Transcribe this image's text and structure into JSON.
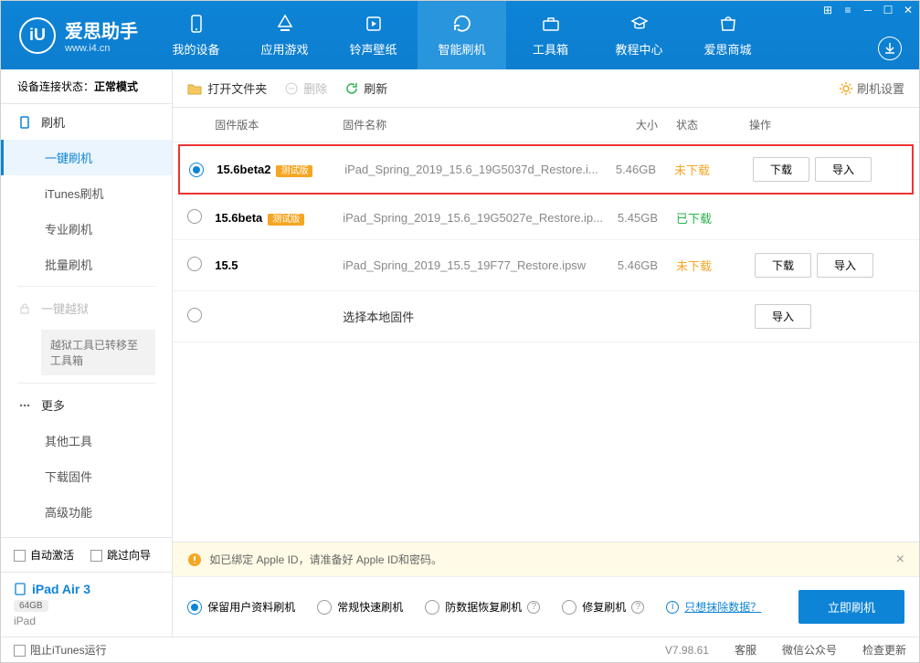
{
  "logo": {
    "text": "爱思助手",
    "sub": "www.i4.cn",
    "initial": "iU"
  },
  "nav": [
    {
      "label": "我的设备",
      "icon": "device"
    },
    {
      "label": "应用游戏",
      "icon": "apps"
    },
    {
      "label": "铃声壁纸",
      "icon": "ringtone"
    },
    {
      "label": "智能刷机",
      "icon": "flash",
      "active": true
    },
    {
      "label": "工具箱",
      "icon": "toolbox"
    },
    {
      "label": "教程中心",
      "icon": "tutorial"
    },
    {
      "label": "爱思商城",
      "icon": "store"
    }
  ],
  "sidebar": {
    "conn_label": "设备连接状态：",
    "conn_value": "正常模式",
    "groups": {
      "flash": {
        "title": "刷机",
        "items": [
          "一键刷机",
          "iTunes刷机",
          "专业刷机",
          "批量刷机"
        ]
      },
      "jailbreak": {
        "title": "一键越狱",
        "note": "越狱工具已转移至工具箱"
      },
      "more": {
        "title": "更多",
        "items": [
          "其他工具",
          "下载固件",
          "高级功能"
        ]
      }
    },
    "bottom": {
      "auto_activate": "自动激活",
      "skip_guide": "跳过向导",
      "device_name": "iPad Air 3",
      "storage": "64GB",
      "device_type": "iPad"
    }
  },
  "toolbar": {
    "open_folder": "打开文件夹",
    "delete": "删除",
    "refresh": "刷新",
    "settings": "刷机设置"
  },
  "table": {
    "headers": {
      "version": "固件版本",
      "name": "固件名称",
      "size": "大小",
      "status": "状态",
      "action": "操作"
    },
    "rows": [
      {
        "selected": true,
        "version": "15.6beta2",
        "beta": "测试版",
        "name": "iPad_Spring_2019_15.6_19G5037d_Restore.i...",
        "size": "5.46GB",
        "status": "未下载",
        "status_class": "not",
        "buttons": [
          "下载",
          "导入"
        ],
        "highlight": true
      },
      {
        "selected": false,
        "version": "15.6beta",
        "beta": "测试版",
        "name": "iPad_Spring_2019_15.6_19G5027e_Restore.ip...",
        "size": "5.45GB",
        "status": "已下载",
        "status_class": "done",
        "buttons": []
      },
      {
        "selected": false,
        "version": "15.5",
        "beta": "",
        "name": "iPad_Spring_2019_15.5_19F77_Restore.ipsw",
        "size": "5.46GB",
        "status": "未下载",
        "status_class": "not",
        "buttons": [
          "下载",
          "导入"
        ]
      },
      {
        "selected": false,
        "version": "",
        "beta": "",
        "name_override": "选择本地固件",
        "size": "",
        "status": "",
        "status_class": "",
        "buttons": [
          "导入"
        ]
      }
    ]
  },
  "bottom": {
    "warning": "如已绑定 Apple ID，请准备好 Apple ID和密码。",
    "options": [
      {
        "label": "保留用户资料刷机",
        "selected": true,
        "help": false
      },
      {
        "label": "常规快速刷机",
        "selected": false,
        "help": false
      },
      {
        "label": "防数据恢复刷机",
        "selected": false,
        "help": true
      },
      {
        "label": "修复刷机",
        "selected": false,
        "help": true
      }
    ],
    "erase_link": "只想抹除数据？",
    "flash_btn": "立即刷机"
  },
  "footer": {
    "block_itunes": "阻止iTunes运行",
    "version": "V7.98.61",
    "items": [
      "客服",
      "微信公众号",
      "检查更新"
    ]
  }
}
